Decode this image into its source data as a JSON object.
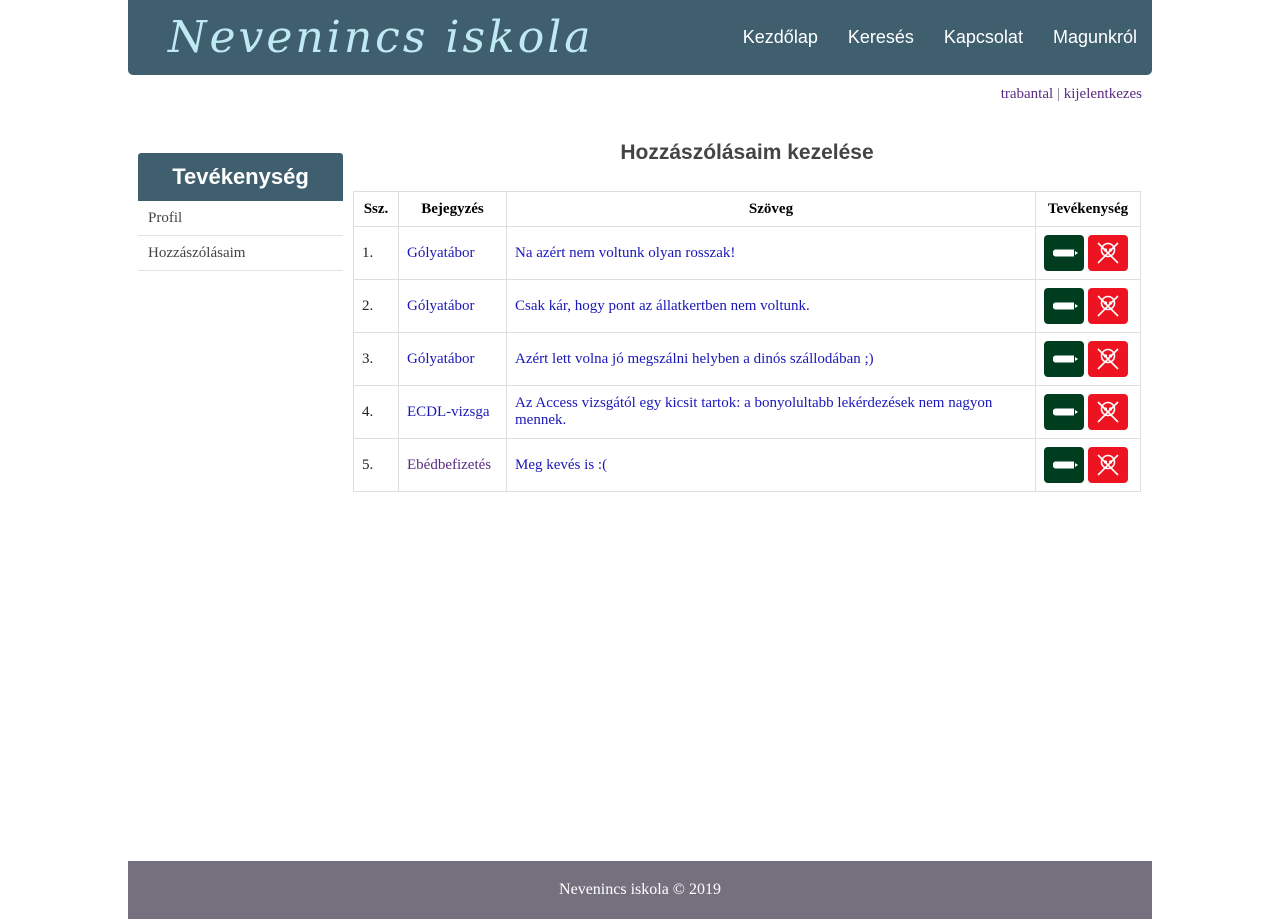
{
  "header": {
    "logo": "Nevenincs iskola",
    "nav": [
      "Kezdőlap",
      "Keresés",
      "Kapcsolat",
      "Magunkról"
    ]
  },
  "userbar": {
    "username": "trabantal",
    "separator": "|",
    "logout": "kijelentkezes"
  },
  "sidebar": {
    "title": "Tevékenység",
    "items": [
      "Profil",
      "Hozzászólásaim"
    ]
  },
  "main": {
    "title": "Hozzászólásaim kezelése",
    "table": {
      "headers": [
        "Ssz.",
        "Bejegyzés",
        "Szöveg",
        "Tevékenység"
      ],
      "rows": [
        {
          "num": "1.",
          "entry": "Gólyatábor",
          "text": "Na azért nem voltunk olyan rosszak!"
        },
        {
          "num": "2.",
          "entry": "Gólyatábor",
          "text": "Csak kár, hogy pont az állatkertben nem voltunk."
        },
        {
          "num": "3.",
          "entry": "Gólyatábor",
          "text": "Azért lett volna jó megszálni helyben a dinós szállodában ;)"
        },
        {
          "num": "4.",
          "entry": "ECDL-vizsga",
          "text": "Az Access vizsgától egy kicsit tartok: a bonyolultabb lekérdezések nem nagyon mennek."
        },
        {
          "num": "5.",
          "entry": "Ebédbefizetés",
          "text": "Meg kevés is :("
        }
      ]
    },
    "action_icons": [
      "pencil-icon",
      "skull-crossbones-icon"
    ]
  },
  "footer": {
    "text": "Nevenincs iskola © 2019"
  },
  "colors": {
    "header_bg": "#3f5f6f",
    "edit_button": "#003d1f",
    "delete_button": "#ee1320",
    "footer_bg": "#74707e",
    "link": "#1a18b8",
    "visited_link": "#5a2d80"
  }
}
